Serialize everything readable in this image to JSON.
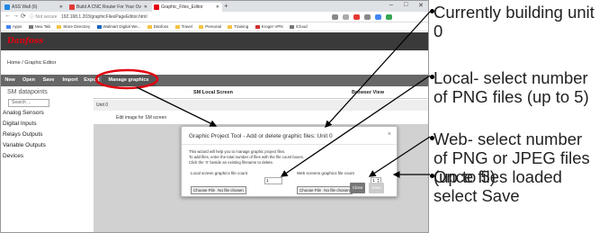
{
  "browser": {
    "tabs": [
      {
        "title": "ASS Wall (6)",
        "active": false,
        "color": "#1e88e5"
      },
      {
        "title": "Build A CNC Router For Your Ov",
        "active": false,
        "color": "#e53935"
      },
      {
        "title": "Graphic_Files_Editor",
        "active": true,
        "color": "#e2000f"
      }
    ],
    "new_tab": "+",
    "window_controls": [
      "–",
      "□",
      "✕"
    ],
    "nav": [
      "←",
      "→",
      "⟳"
    ],
    "url_security": "ⓘ Not secure",
    "url": "192.168.1.203/graphicFilesPageEditor.html",
    "bookmarks": [
      "Apps",
      "New Tab",
      "Store Directory",
      "Walmart Digital We...",
      "Danfoss",
      "Travel",
      "Personal",
      "Training",
      "Kroger VPN",
      "iCloud"
    ]
  },
  "app": {
    "logo": "Danfoss",
    "breadcrumb": "Home  /  Graphic Editor",
    "toolbar": [
      "New",
      "Open",
      "Save",
      "Import",
      "Export",
      "Manage graphics"
    ],
    "accent": "#e2000f"
  },
  "left_panel": {
    "title": "SM datapoints",
    "search_placeholder": "Search ...",
    "items": [
      "Analog Sensors",
      "Digital Inputs",
      "Relays Outputs",
      "Variable Outputs",
      "Devices"
    ]
  },
  "main": {
    "col_sm": "SM Local Screen",
    "col_browser": "Browser View",
    "unit_row": "Unit 0",
    "edit_row": "Edit image for SM screen"
  },
  "modal": {
    "title": "Graphic Project Tool - Add or delete graphic files: Unit 0",
    "close": "×",
    "lines": [
      "This wizard will help you to manage graphic project files.",
      "To add files, enter the total number of files with the file count boxes.",
      "Click the 'X' beside an existing filename to delete."
    ],
    "local_label": "Local screen graphics file count",
    "local_value": "1",
    "web_label": "Web screens graphics file count",
    "web_value": "1",
    "file_button": "Choose File",
    "file_status": "No file chosen",
    "btn_close": "Close",
    "btn_save": "Save"
  },
  "annotations": [
    "Currently building unit 0",
    "Local- select number of PNG files (up to 5)",
    "Web- select number of PNG or JPEG files (up to 5)",
    "Once files loaded select Save"
  ]
}
